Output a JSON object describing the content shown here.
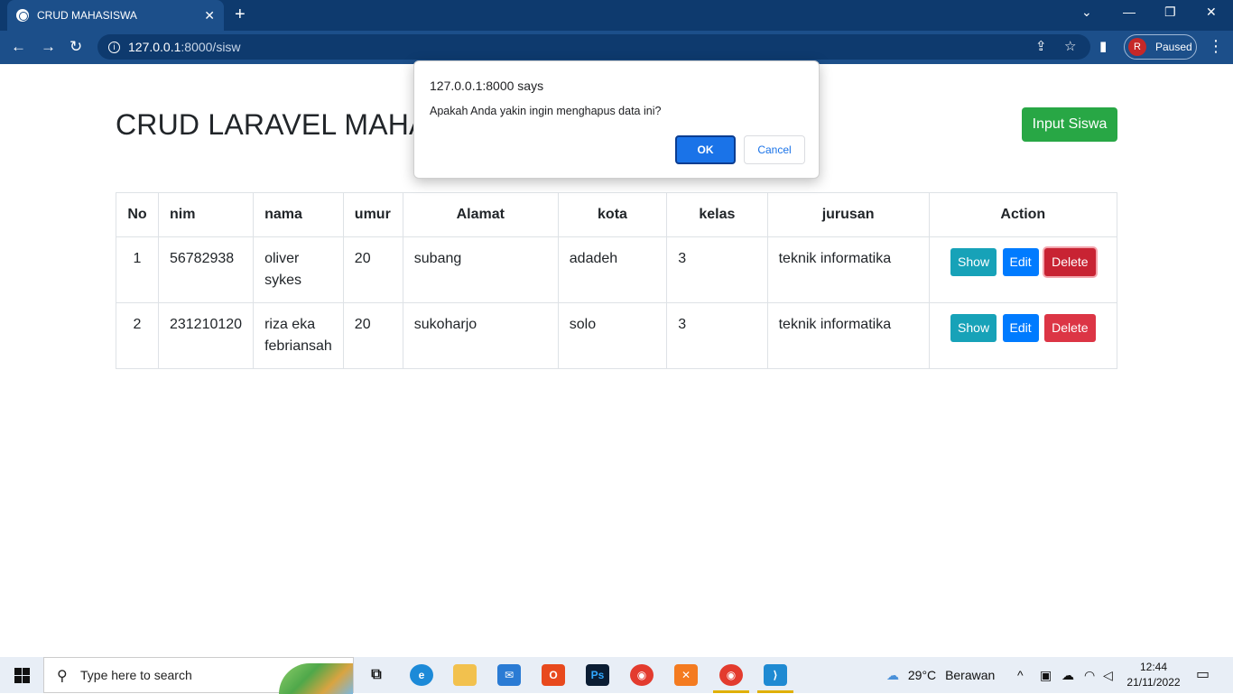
{
  "browser": {
    "tab_title": "CRUD MAHASISWA",
    "url_host": "127.0.0.1",
    "url_rest": ":8000/sisw",
    "profile_initial": "R",
    "profile_status": "Paused"
  },
  "page": {
    "title": "CRUD LARAVEL MAHA",
    "input_button": "Input Siswa"
  },
  "table": {
    "headers": [
      "No",
      "nim",
      "nama",
      "umur",
      "Alamat",
      "kota",
      "kelas",
      "jurusan",
      "Action"
    ],
    "rows": [
      {
        "no": "1",
        "nim": "56782938",
        "nama": "oliver sykes",
        "umur": "20",
        "alamat": "subang",
        "kota": "adadeh",
        "kelas": "3",
        "jurusan": "teknik informatika"
      },
      {
        "no": "2",
        "nim": "231210120",
        "nama": "riza eka febriansah",
        "umur": "20",
        "alamat": "sukoharjo",
        "kota": "solo",
        "kelas": "3",
        "jurusan": "teknik informatika"
      }
    ],
    "actions": {
      "show": "Show",
      "edit": "Edit",
      "delete": "Delete"
    }
  },
  "dialog": {
    "title": "127.0.0.1:8000 says",
    "message": "Apakah Anda yakin ingin menghapus data ini?",
    "ok": "OK",
    "cancel": "Cancel"
  },
  "taskbar": {
    "search_placeholder": "Type here to search",
    "temperature": "29°C",
    "weather": "Berawan",
    "time": "12:44",
    "date": "21/11/2022"
  },
  "colors": {
    "chrome_dark": "#0e3a6e",
    "chrome_light": "#1c4f8a",
    "success": "#28a745",
    "info": "#17a2b8",
    "primary": "#007bff",
    "danger": "#dc3545"
  }
}
